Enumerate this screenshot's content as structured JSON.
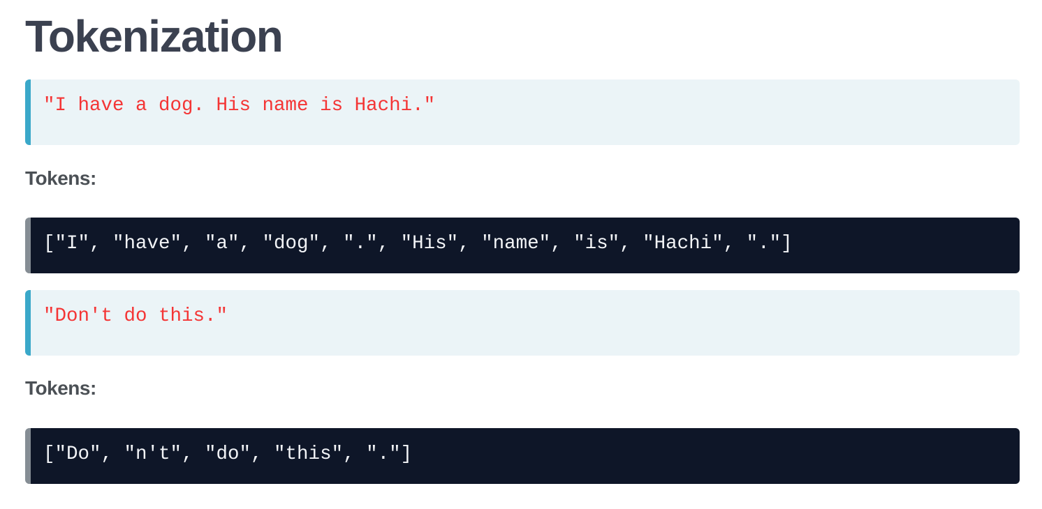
{
  "title": "Tokenization",
  "examples": [
    {
      "sentence": "\"I have a dog. His name is Hachi.\"",
      "tokens_label": "Tokens:",
      "tokens": "[\"I\", \"have\", \"a\", \"dog\", \".\", \"His\", \"name\", \"is\", \"Hachi\", \".\"]"
    },
    {
      "sentence": "\"Don't do this.\"",
      "tokens_label": "Tokens:",
      "tokens": "[\"Do\", \"n't\", \"do\", \"this\", \".\"]"
    }
  ],
  "colors": {
    "accent": "#3aa8c9",
    "string": "#f43535",
    "code_bg": "#0e1628"
  }
}
